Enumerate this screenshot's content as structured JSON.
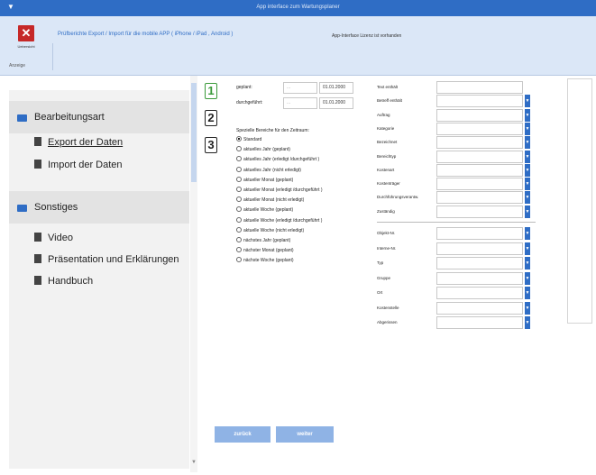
{
  "window": {
    "title": "App interface zum Wartungsplaner"
  },
  "ribbon": {
    "close_label": "Uebersicht",
    "group_label": "Anzeige",
    "info_text": "Prüfberichte Export / Import für die mobile APP ( iPhone / iPad , Android )",
    "license_text": "App-Interface Lizenz ist vorhanden"
  },
  "sidebar": {
    "section1": "Bearbeitungsart",
    "items1": [
      "Export der Daten",
      "Import  der Daten"
    ],
    "section2": "Sonstiges",
    "items2": [
      "Video",
      "Präsentation und Erklärungen",
      "Handbuch"
    ]
  },
  "dates": {
    "geplant_label": "geplant:",
    "geplant_date": "01.01.2000",
    "durchgefuehrt_label": "durchgeführt:",
    "durchgefuehrt_date": "01.01.2000"
  },
  "period": {
    "label": "Spezielle Bereiche für den Zeitraum:",
    "options": [
      "Standard",
      "aktuelles Jahr (geplant)",
      "aktuelles Jahr (erledigt /durchgeführt )",
      "aktuelles Jahr (nicht erledigt)",
      "aktueller Monat (geplant)",
      "aktueller Monat (erledigt /durchgeführt )",
      "aktueller Monat (nicht erledigt)",
      "aktuelle Woche (geplant)",
      "aktuelle Woche (erledigt /durchgeführt )",
      "aktuelle Woche (nicht erledigt)",
      "nächstes Jahr (geplant)",
      "nächster Monat (geplant)",
      "nächste Woche (geplant)"
    ],
    "selected": 0
  },
  "filters_top": [
    "Text enthält",
    "Betreff enthält",
    "Auftrag",
    "Kategorie",
    "Bezeichnet",
    "Bereichtyp",
    "Kostenart",
    "Kostenträger",
    "Durchführungsverantw.",
    "Zuständig"
  ],
  "filters_bottom": [
    "Objekt-Nr.",
    "Interne-Nr.",
    "Typ",
    "Gruppe",
    "Ort",
    "Kostenstelle",
    "Abgerissen"
  ],
  "buttons": {
    "back": "zurück",
    "next": "weiter"
  }
}
